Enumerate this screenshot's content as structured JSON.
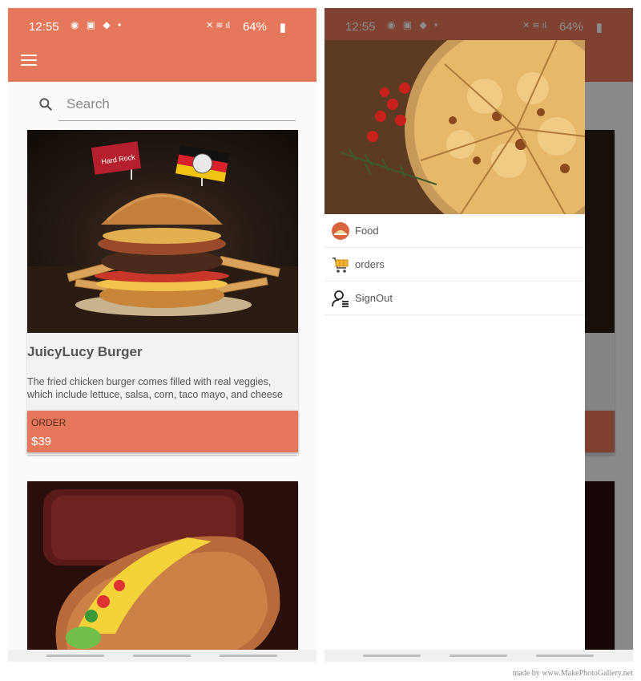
{
  "status_bar": {
    "time": "12:55",
    "battery": "64%",
    "left_icons": "◉ ▣ ◆ •",
    "right_icons": "✕ ≋ ıl"
  },
  "search": {
    "placeholder": "Search"
  },
  "products": [
    {
      "title": "JuicyLucy Burger",
      "description": "The fried chicken burger comes filled with real veggies, which include lettuce, salsa, corn, taco mayo, and cheese",
      "order_label": "ORDER",
      "price": "$39"
    }
  ],
  "drawer": {
    "items": [
      {
        "label": "Food",
        "icon": "food-icon"
      },
      {
        "label": "orders",
        "icon": "cart-icon"
      },
      {
        "label": "SignOut",
        "icon": "user-signout-icon"
      }
    ]
  },
  "watermark": "made by www.MakePhotoGallery.net",
  "colors": {
    "accent": "#e5775b",
    "background": "#fafafa",
    "text": "#555555"
  }
}
